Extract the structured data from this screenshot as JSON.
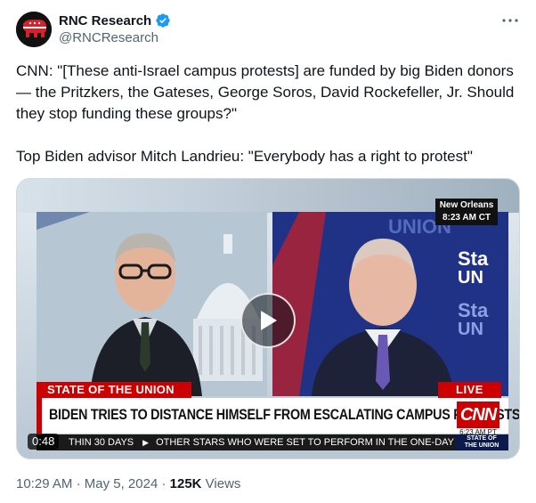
{
  "author": {
    "display_name": "RNC Research",
    "handle": "@RNCResearch",
    "verified": true,
    "avatar_icon": "republican-elephant-icon"
  },
  "tweet": {
    "paragraph1": "CNN: \"[These anti-Israel campus protests] are funded by big Biden donors — the Pritzkers, the Gateses, George Soros, David Rockefeller, Jr. Should they stop funding these groups?\"",
    "paragraph2": "Top Biden advisor Mitch Landrieu: \"Everybody has a right to protest\""
  },
  "media": {
    "location_line1": "New Orleans",
    "location_line2": "8:23 AM CT",
    "show_name": "STATE OF THE UNION",
    "live_label": "LIVE",
    "headline": "BIDEN TRIES TO DISTANCE HIMSELF FROM ESCALATING CAMPUS PROTESTS",
    "network_logo": "CNN",
    "network_time": "6:23 AM PT",
    "ticker_left": "THIN 30 DAYS",
    "ticker_right": "OTHER STARS WHO WERE SET TO PERFORM IN THE ONE-DAY FE",
    "badge_line1": "STATE OF",
    "badge_line2": "THE UNION",
    "duration": "0:48",
    "play_icon": "play-icon"
  },
  "meta": {
    "time": "10:29 AM",
    "separator": "·",
    "date": "May 5, 2024",
    "views_count": "125K",
    "views_label": "Views"
  },
  "colors": {
    "accent_blue": "#1d9bf0",
    "cnn_red": "#cc0000",
    "secondary_text": "#536471"
  }
}
